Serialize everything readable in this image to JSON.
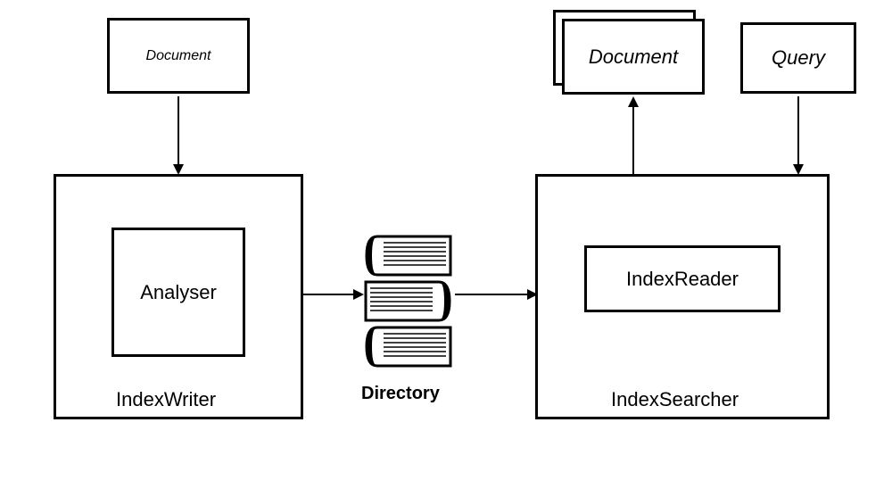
{
  "document_label": "Document",
  "index_writer_label": "IndexWriter",
  "analyser_label": "Analyser",
  "directory_label": "Directory",
  "index_searcher_label": "IndexSearcher",
  "index_reader_label": "IndexReader",
  "documents_label": "Document",
  "query_label": "Query"
}
